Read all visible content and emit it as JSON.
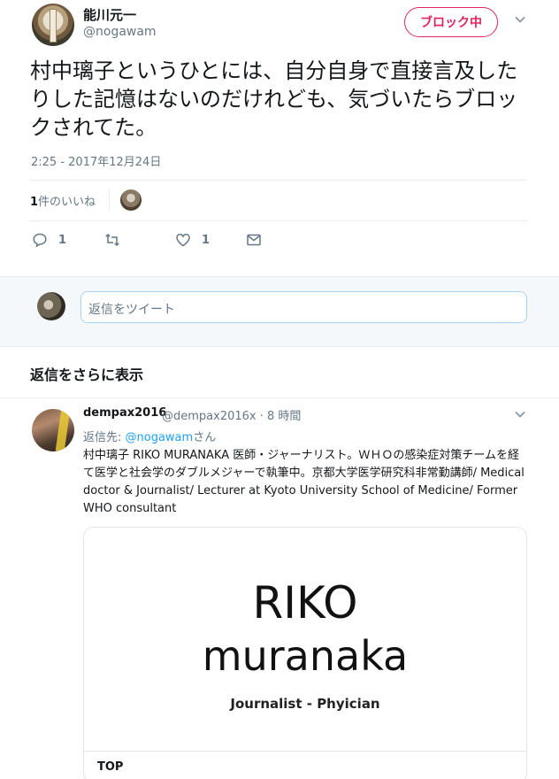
{
  "tweet": {
    "display_name": "能川元一",
    "handle": "@nogawam",
    "block_button": "ブロック中",
    "text": "村中璃子というひとには、自分自身で直接言及したりした記憶はないのだけれども、気づいたらブロックされてた。",
    "timestamp": "2:25 - 2017年12月24日",
    "likes": {
      "count": "1",
      "label": "件のいいね"
    },
    "actions": {
      "reply_count": "1",
      "retweet_count": "",
      "like_count": "1"
    }
  },
  "reply_box": {
    "placeholder": "返信をツイート"
  },
  "more_replies": {
    "label": "返信をさらに表示"
  },
  "reply_tweet": {
    "display_name": "dempax2016",
    "handle": "@dempax2016x",
    "time": "· 8 時間",
    "reply_to_prefix": "返信先: ",
    "reply_to_mention": "@nogawam",
    "reply_to_suffix": "さん",
    "text": "村中璃子 RIKO MURANAKA 医師・ジャーナリスト。ＷＨＯの感染症対策チームを経て医学と社会学のダブルメジャーで執筆中。京都大学医学研究科非常勤講師/ Medical doctor & Journalist/ Lecturer at Kyoto University School of Medicine/ Former WHO consultant",
    "card": {
      "title_line1": "RIKO",
      "title_line2": "muranaka",
      "subtitle": "Journalist - Phyician",
      "footer": "TOP"
    }
  },
  "colors": {
    "accent": "#1da1f2",
    "block": "#e0245e",
    "muted": "#657786"
  }
}
